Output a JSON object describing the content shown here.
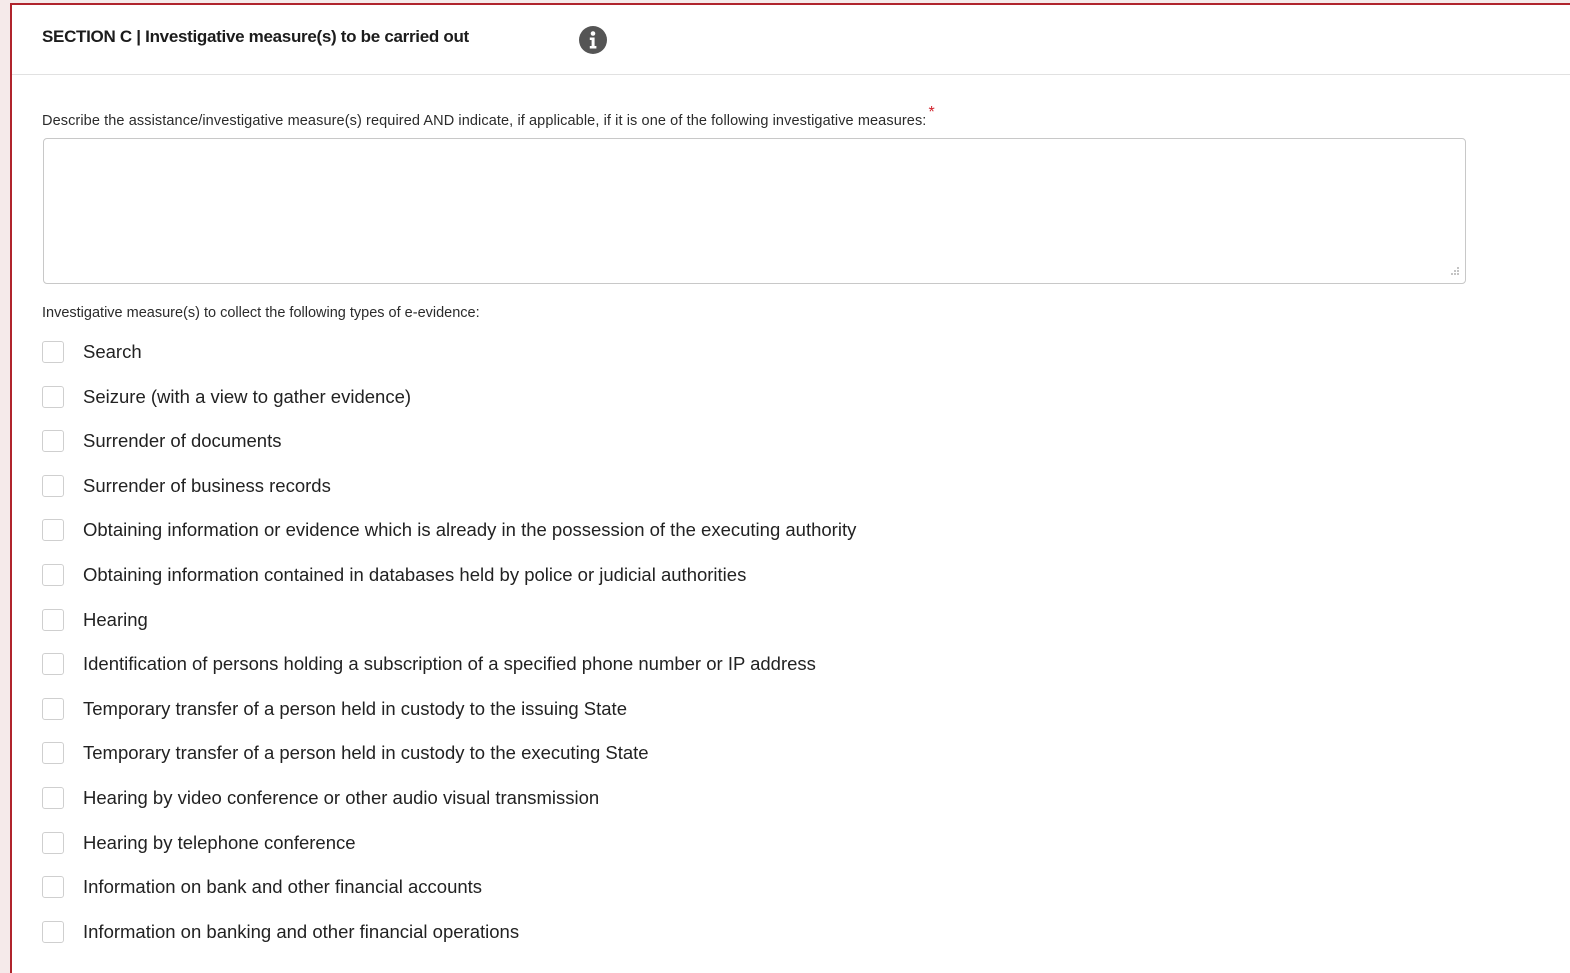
{
  "section": {
    "title": "SECTION C | Investigative measure(s) to be carried out",
    "info_icon": "info-circle-icon"
  },
  "description": {
    "label": "Describe the assistance/investigative measure(s) required AND indicate, if applicable, if it is one of the following investigative measures:",
    "required_marker": "*",
    "value": "",
    "placeholder": ""
  },
  "evidence_types": {
    "label": "Investigative measure(s) to collect the following types of e-evidence:",
    "items": [
      {
        "label": "Search",
        "checked": false
      },
      {
        "label": "Seizure (with a view to gather evidence)",
        "checked": false
      },
      {
        "label": "Surrender of documents",
        "checked": false
      },
      {
        "label": "Surrender of business records",
        "checked": false
      },
      {
        "label": "Obtaining information or evidence which is already in the possession of the executing authority",
        "checked": false
      },
      {
        "label": "Obtaining information contained in databases held by police or judicial authorities",
        "checked": false
      },
      {
        "label": "Hearing",
        "checked": false
      },
      {
        "label": "Identification of persons holding a subscription of a specified phone number or IP address",
        "checked": false
      },
      {
        "label": "Temporary transfer of a person held in custody to the issuing State",
        "checked": false
      },
      {
        "label": "Temporary transfer of a person held in custody to the executing State",
        "checked": false
      },
      {
        "label": "Hearing by video conference or other audio visual transmission",
        "checked": false
      },
      {
        "label": "Hearing by telephone conference",
        "checked": false
      },
      {
        "label": "Information on bank and other financial accounts",
        "checked": false
      },
      {
        "label": "Information on banking and other financial operations",
        "checked": false
      }
    ]
  },
  "colors": {
    "accent_border": "#b0242c",
    "required": "#d0202a",
    "info_icon": "#555555"
  }
}
